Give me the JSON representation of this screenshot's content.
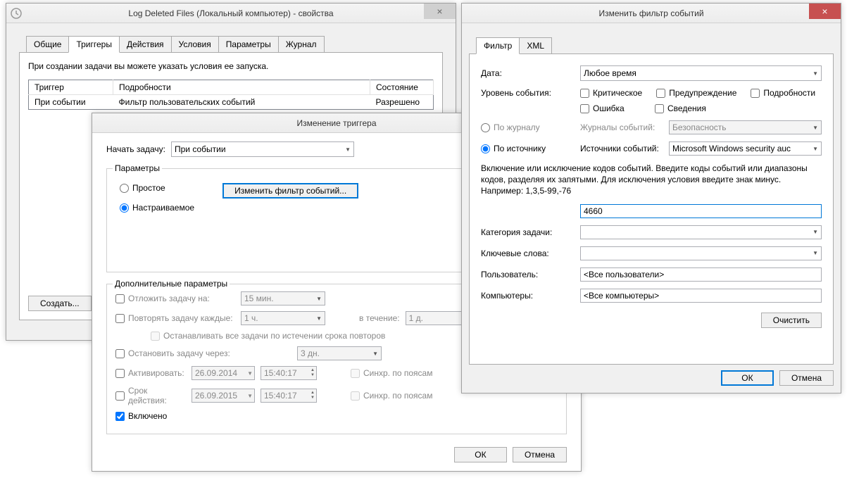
{
  "props": {
    "title": "Log Deleted Files (Локальный компьютер) - свойства",
    "tabs": [
      "Общие",
      "Триггеры",
      "Действия",
      "Условия",
      "Параметры",
      "Журнал"
    ],
    "description": "При создании задачи вы можете указать условия ее запуска.",
    "table": {
      "headers": [
        "Триггер",
        "Подробности",
        "Состояние"
      ],
      "row": [
        "При событии",
        "Фильтр пользовательских событий",
        "Разрешено"
      ]
    },
    "create_btn": "Создать..."
  },
  "trigger": {
    "title": "Изменение триггера",
    "start_label": "Начать задачу:",
    "start_value": "При событии",
    "params_legend": "Параметры",
    "radio_simple": "Простое",
    "radio_custom": "Настраиваемое",
    "edit_filter_btn": "Изменить фильтр событий...",
    "adv_legend": "Дополнительные параметры",
    "delay_label": "Отложить задачу на:",
    "delay_value": "15 мин.",
    "repeat_label": "Повторять задачу каждые:",
    "repeat_value": "1 ч.",
    "duration_label": "в течение:",
    "duration_value": "1 д.",
    "stopall_label": "Останавливать все задачи по истечении срока повторов",
    "stopafter_label": "Остановить задачу через:",
    "stopafter_value": "3 дн.",
    "activate_label": "Активировать:",
    "activate_date": "26.09.2014",
    "activate_time": "15:40:17",
    "expire_label": "Срок действия:",
    "expire_date": "26.09.2015",
    "expire_time": "15:40:17",
    "sync_label": "Синхр. по поясам",
    "enabled_label": "Включено",
    "ok": "ОК",
    "cancel": "Отмена"
  },
  "filter": {
    "title": "Изменить фильтр событий",
    "tabs": [
      "Фильтр",
      "XML"
    ],
    "date_label": "Дата:",
    "date_value": "Любое время",
    "level_label": "Уровень события:",
    "lvl_critical": "Критическое",
    "lvl_warning": "Предупреждение",
    "lvl_verbose": "Подробности",
    "lvl_error": "Ошибка",
    "lvl_info": "Сведения",
    "by_log": "По журналу",
    "by_source": "По источнику",
    "logs_label": "Журналы событий:",
    "logs_value": "Безопасность",
    "sources_label": "Источники событий:",
    "sources_value": "Microsoft Windows security auc",
    "help": "Включение или исключение кодов событий. Введите коды событий или диапазоны кодов, разделяя их запятыми. Для исключения условия введите знак минус. Например: 1,3,5-99,-76",
    "ids_value": "4660",
    "taskcat_label": "Категория задачи:",
    "keywords_label": "Ключевые слова:",
    "user_label": "Пользователь:",
    "user_value": "<Все пользователи>",
    "computers_label": "Компьютеры:",
    "computers_value": "<Все компьютеры>",
    "clear_btn": "Очистить",
    "ok": "ОК",
    "cancel": "Отмена"
  }
}
